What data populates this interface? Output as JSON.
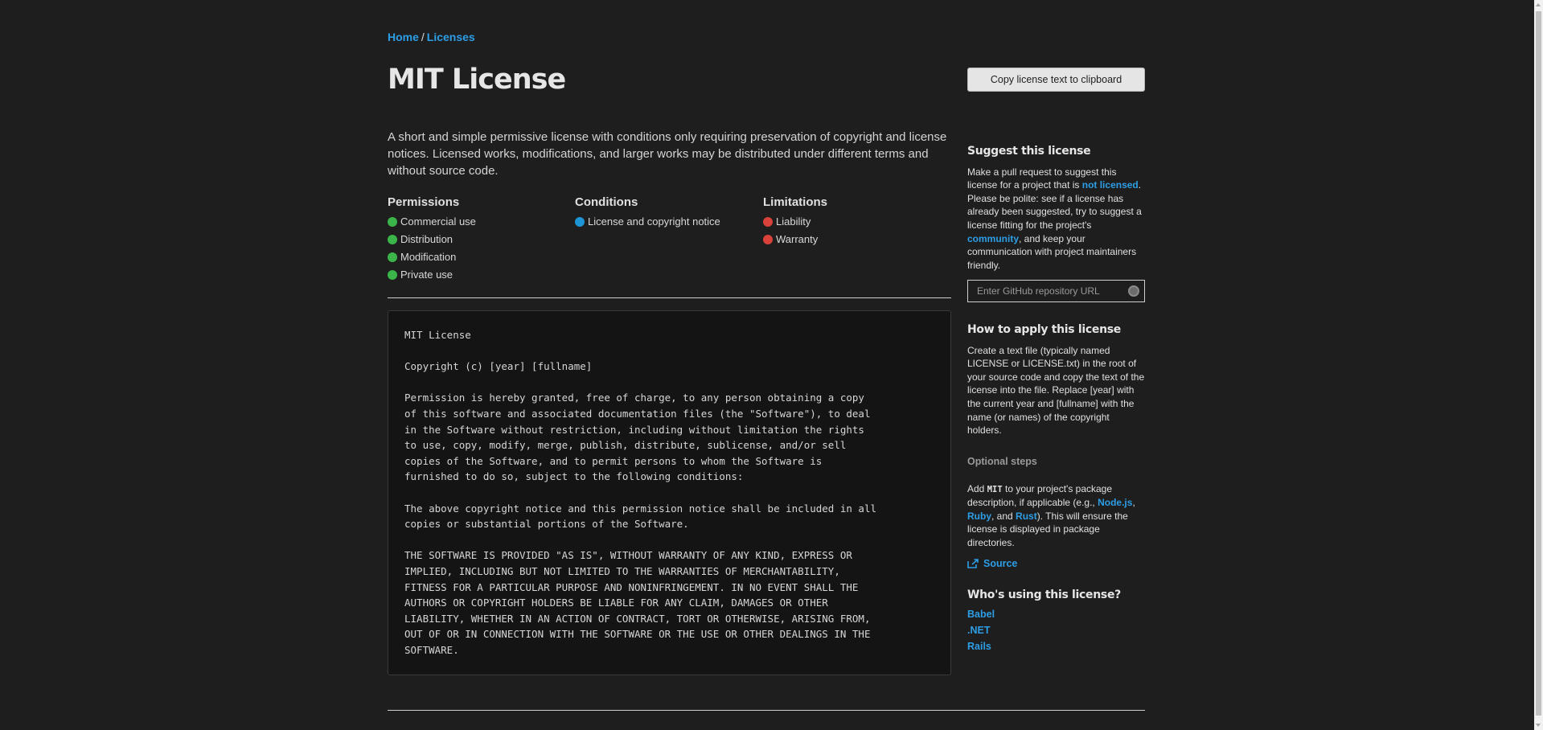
{
  "breadcrumb": {
    "home": "Home",
    "separator": "/",
    "licenses": "Licenses"
  },
  "title": "MIT License",
  "copy_button": "Copy license text to clipboard",
  "description": "A short and simple permissive license with conditions only requiring preservation of copyright and license notices. Licensed works, modifications, and larger works may be distributed under different terms and without source code.",
  "colors": {
    "permission": "#3bb54a",
    "condition": "#1e95d4",
    "limitation": "#d9413b",
    "link": "#2d9ee6"
  },
  "permissions": {
    "heading": "Permissions",
    "items": [
      "Commercial use",
      "Distribution",
      "Modification",
      "Private use"
    ]
  },
  "conditions": {
    "heading": "Conditions",
    "items": [
      "License and copyright notice"
    ]
  },
  "limitations": {
    "heading": "Limitations",
    "items": [
      "Liability",
      "Warranty"
    ]
  },
  "license_text": "MIT License\n\nCopyright (c) [year] [fullname]\n\nPermission is hereby granted, free of charge, to any person obtaining a copy\nof this software and associated documentation files (the \"Software\"), to deal\nin the Software without restriction, including without limitation the rights\nto use, copy, modify, merge, publish, distribute, sublicense, and/or sell\ncopies of the Software, and to permit persons to whom the Software is\nfurnished to do so, subject to the following conditions:\n\nThe above copyright notice and this permission notice shall be included in all\ncopies or substantial portions of the Software.\n\nTHE SOFTWARE IS PROVIDED \"AS IS\", WITHOUT WARRANTY OF ANY KIND, EXPRESS OR\nIMPLIED, INCLUDING BUT NOT LIMITED TO THE WARRANTIES OF MERCHANTABILITY,\nFITNESS FOR A PARTICULAR PURPOSE AND NONINFRINGEMENT. IN NO EVENT SHALL THE\nAUTHORS OR COPYRIGHT HOLDERS BE LIABLE FOR ANY CLAIM, DAMAGES OR OTHER\nLIABILITY, WHETHER IN AN ACTION OF CONTRACT, TORT OR OTHERWISE, ARISING FROM,\nOUT OF OR IN CONNECTION WITH THE SOFTWARE OR THE USE OR OTHER DEALINGS IN THE\nSOFTWARE.",
  "sidebar": {
    "suggest": {
      "heading": "Suggest this license",
      "text1": "Make a pull request to suggest this license for a project that is ",
      "link1": "not licensed",
      "text2": ". Please be polite: see if a license has already been suggested, try to suggest a license fitting for the project's ",
      "link2": "community",
      "text3": ", and keep your communication with project maintainers friendly.",
      "input_placeholder": "Enter GitHub repository URL"
    },
    "apply": {
      "heading": "How to apply this license",
      "text": "Create a text file (typically named LICENSE or LICENSE.txt) in the root of your source code and copy the text of the license into the file. Replace [year] with the current year and [fullname] with the name (or names) of the copyright holders."
    },
    "optional": {
      "heading": "Optional steps",
      "t1": "Add ",
      "code": "MIT",
      "t2": " to your project's package description, if applicable (e.g., ",
      "l1": "Node.js",
      "t3": ", ",
      "l2": "Ruby",
      "t4": ", and ",
      "l3": "Rust",
      "t5": "). This will ensure the license is displayed in package directories."
    },
    "source_link": "Source",
    "users": {
      "heading": "Who's using this license?",
      "items": [
        "Babel",
        ".NET",
        "Rails"
      ]
    }
  }
}
